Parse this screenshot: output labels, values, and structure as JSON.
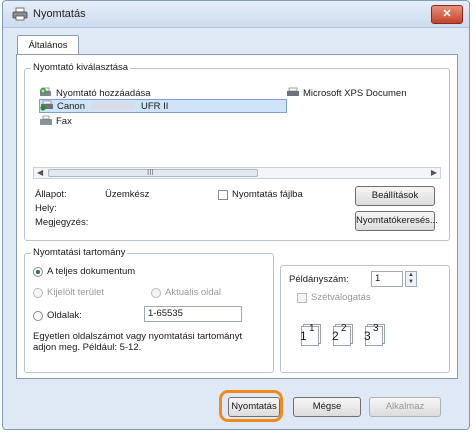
{
  "window": {
    "title": "Nyomtatás",
    "close_label": "✕"
  },
  "tab": {
    "label": "Általános"
  },
  "printer_group": {
    "title": "Nyomtató kiválasztása",
    "printers": [
      {
        "label": "Nyomtató hozzáadása",
        "icon": "add-printer-icon"
      },
      {
        "label": "Microsoft XPS Documen",
        "icon": "printer-icon"
      },
      {
        "label_prefix": "Canon",
        "label_suffix": "UFR II",
        "icon": "printer-default-icon",
        "selected": true
      },
      {
        "label": "Fax",
        "icon": "fax-icon"
      }
    ],
    "scroll_center": "III",
    "status_label": "Állapot:",
    "status_value": "Üzemkész",
    "location_label": "Hely:",
    "comment_label": "Megjegyzés:",
    "print_to_file_label": "Nyomtatás fájlba",
    "preferences_button": "Beállítások",
    "find_printer_button": "Nyomtatókeresés..."
  },
  "range_group": {
    "title": "Nyomtatási tartomány",
    "all_pages": "A teljes dokumentum",
    "selection": "Kijelölt terület",
    "current_page": "Aktuális oldal",
    "pages": "Oldalak:",
    "pages_value": "1-65535",
    "hint": "Egyetlen oldalszámot vagy nyomtatási tartományt adjon meg. Például: 5-12."
  },
  "copies_group": {
    "copies_label": "Példányszám:",
    "copies_value": "1",
    "collate_label": "Szétválogatás",
    "collate_pages": [
      "1",
      "1",
      "2",
      "2",
      "3",
      "3"
    ]
  },
  "footer": {
    "print_button": "Nyomtatás",
    "cancel_button": "Mégse",
    "apply_button": "Alkalmaz"
  },
  "colors": {
    "highlight": "#f08a1c",
    "selection": "#cfe4f8"
  }
}
